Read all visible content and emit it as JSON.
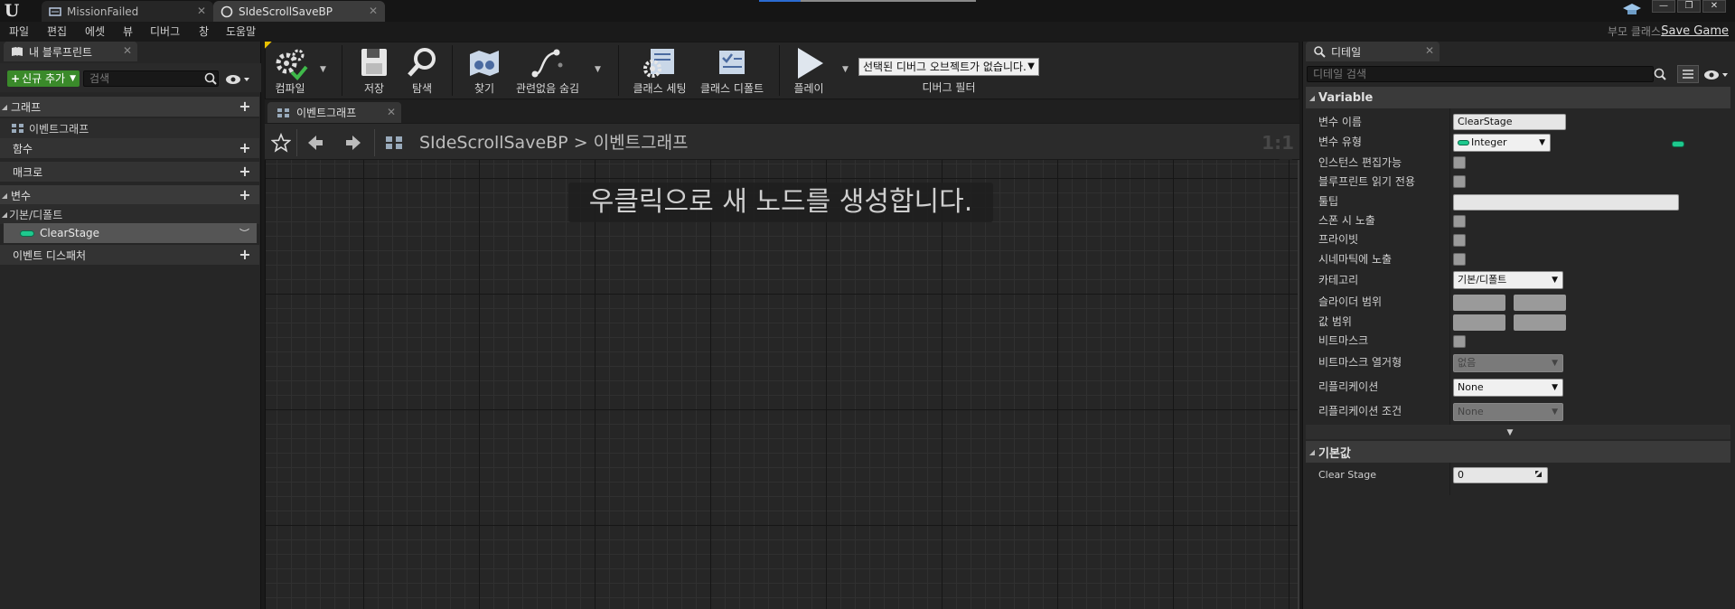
{
  "window": {
    "tabs": [
      {
        "label": "MissionFailed",
        "active": false
      },
      {
        "label": "SIdeScrollSaveBP",
        "active": true
      }
    ],
    "parent_class_label": "부모 클래스:",
    "parent_class_value": "Save Game"
  },
  "menu": [
    "파일",
    "편집",
    "에셋",
    "뷰",
    "디버그",
    "창",
    "도움말"
  ],
  "toolbar": {
    "compile": "컴파일",
    "save": "저장",
    "browse": "탐색",
    "find": "찾기",
    "hide_unrelated": "관련없음 숨김",
    "class_settings": "클래스 세팅",
    "class_defaults": "클래스 디폴트",
    "play": "플레이",
    "debug_object": "선택된 디버그 오브젝트가 없습니다.",
    "debug_filter": "디버그 필터"
  },
  "my_blueprint": {
    "tab_title": "내 블루프린트",
    "add_new": "신규 추가",
    "search_placeholder": "검색",
    "sections": {
      "graphs": "그래프",
      "event_graph": "이벤트그래프",
      "functions": "함수",
      "macros": "매크로",
      "variables": "변수",
      "default_category": "기본/디폴트",
      "clear_stage_var": "ClearStage",
      "event_dispatchers": "이벤트 디스패처"
    }
  },
  "graph": {
    "tab_title": "이벤트그래프",
    "breadcrumb_bp": "SIdeScrollSaveBP",
    "breadcrumb_sep": ">",
    "breadcrumb_graph": "이벤트그래프",
    "zoom": "1:1 줌",
    "hint": "우클릭으로 새 노드를 생성합니다."
  },
  "details": {
    "tab_title": "디테일",
    "search_placeholder": "디테일 검색",
    "variable_category": "Variable",
    "props": {
      "var_name_label": "변수 이름",
      "var_name_value": "ClearStage",
      "var_type_label": "변수 유형",
      "var_type_value": "Integer",
      "instance_editable": "인스턴스 편집가능",
      "bp_read_only": "블루프린트 읽기 전용",
      "tooltip": "툴팁",
      "expose_on_spawn": "스폰 시 노출",
      "private": "프라이빗",
      "expose_cinematics": "시네마틱에 노출",
      "category_label": "카테고리",
      "category_value": "기본/디폴트",
      "slider_range": "슬라이더 범위",
      "value_range": "값 범위",
      "bitmask": "비트마스크",
      "bitmask_enum_label": "비트마스크 열거형",
      "bitmask_enum_value": "없음",
      "replication_label": "리플리케이션",
      "replication_value": "None",
      "replication_cond_label": "리플리케이션 조건",
      "replication_cond_value": "None"
    },
    "default_value_category": "기본값",
    "default_prop_label": "Clear Stage",
    "default_prop_value": "0"
  },
  "colors": {
    "integer_pin": "#1ec98e",
    "add_button": "#3a8a2a",
    "progress_accent": "#2b6bd1"
  }
}
